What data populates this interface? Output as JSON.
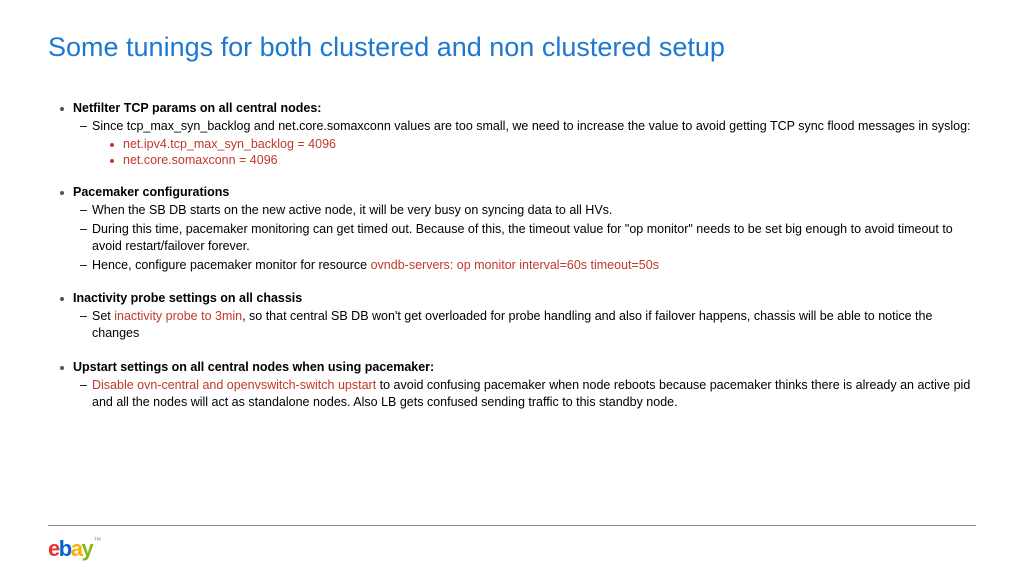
{
  "title": "Some tunings for both clustered and non clustered setup",
  "sections": [
    {
      "heading": "Netfilter TCP params on all central nodes:",
      "items": [
        {
          "type": "sub",
          "text": "Since tcp_max_syn_backlog and net.core.somaxconn values are too small, we need to increase the value to avoid getting TCP sync flood messages in syslog:"
        },
        {
          "type": "subsub_red",
          "text": "net.ipv4.tcp_max_syn_backlog = 4096"
        },
        {
          "type": "subsub_red",
          "text": "net.core.somaxconn = 4096"
        }
      ]
    },
    {
      "heading": "Pacemaker configurations",
      "items": [
        {
          "type": "sub",
          "text": "When the SB DB starts on the new active node, it will be very busy on syncing data to all HVs."
        },
        {
          "type": "sub",
          "text": " During this time, pacemaker monitoring can get timed out. Because of this, the timeout value for \"op monitor\" needs to be set big enough to avoid timeout to avoid restart/failover forever."
        },
        {
          "type": "sub_mixed",
          "pre": "Hence, configure pacemaker monitor for resource ",
          "red": "ovndb-servers: op monitor interval=60s timeout=50s"
        }
      ]
    },
    {
      "heading": "Inactivity probe settings on all chassis",
      "items": [
        {
          "type": "sub_mixed",
          "pre": "Set ",
          "red": "inactivity probe to 3min",
          "post": ", so that central SB DB won't get overloaded for probe handling and also if failover happens, chassis will be able to notice the changes"
        }
      ]
    },
    {
      "heading": "Upstart settings on all central nodes when using pacemaker:",
      "items": [
        {
          "type": "sub_mixed",
          "red_first": "Disable ovn-central and openvswitch-switch upstart",
          "post": " to avoid confusing pacemaker when node reboots because pacemaker thinks there is already an active pid and all the nodes will act as standalone nodes. Also LB gets confused sending traffic to this standby node."
        }
      ]
    }
  ],
  "logo": {
    "e": "e",
    "b": "b",
    "a": "a",
    "y": "y",
    "tm": "™"
  }
}
